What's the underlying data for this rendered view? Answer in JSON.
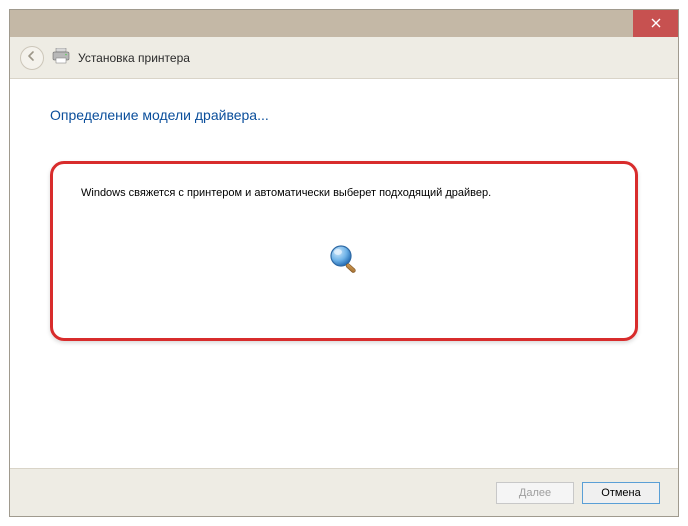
{
  "window": {
    "title": "Установка принтера"
  },
  "page": {
    "heading": "Определение модели драйвера...",
    "status_text": "Windows свяжется с принтером и автоматически выберет подходящий драйвер."
  },
  "buttons": {
    "next": "Далее",
    "cancel": "Отмена"
  },
  "icons": {
    "close": "close-icon",
    "back": "back-arrow-icon",
    "printer": "printer-icon",
    "search": "magnifier-search-icon"
  }
}
